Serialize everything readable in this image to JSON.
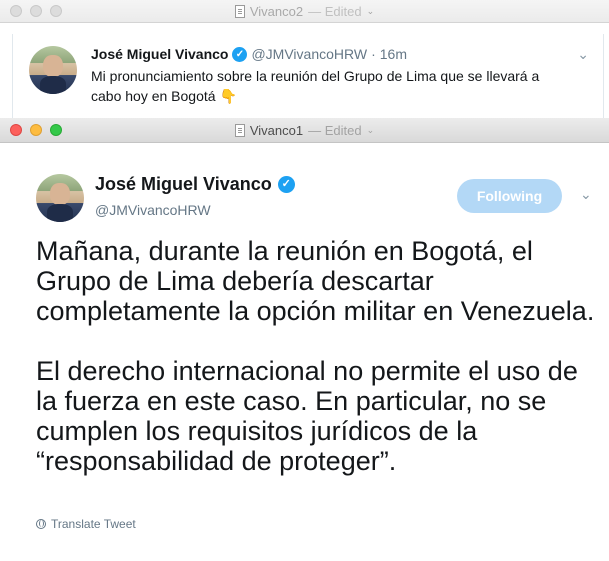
{
  "back_window": {
    "title": "Vivanco2",
    "edited": "— Edited",
    "tweet": {
      "name": "José Miguel Vivanco",
      "handle": "@JMVivancoHRW",
      "separator": "·",
      "time": "16m",
      "text": "Mi pronunciamiento sobre la reunión del Grupo de Lima que se llevará a cabo hoy en Bogotá",
      "emoji": "👇"
    }
  },
  "front_window": {
    "title": "Vivanco1",
    "edited": "— Edited",
    "tweet": {
      "name": "José Miguel Vivanco",
      "handle": "@JMVivancoHRW",
      "follow_label": "Following",
      "paragraph1": "Mañana, durante la reunión en Bogotá, el Grupo de Lima debería descartar completamente la opción militar en Venezuela.",
      "paragraph2": "El derecho internacional no permite el uso de la fuerza en este caso. En particular, no se cumplen los requisitos jurídicos de la “responsabilidad de proteger”.",
      "translate_label": "Translate Tweet"
    }
  },
  "colors": {
    "twitter_blue": "#1da1f2",
    "following_button_disabled": "#b3d8f6",
    "secondary_text": "#657786"
  },
  "icons": {
    "verified": "verified-badge-icon",
    "chevron": "chevron-down-icon",
    "globe": "globe-icon",
    "document": "document-icon"
  }
}
